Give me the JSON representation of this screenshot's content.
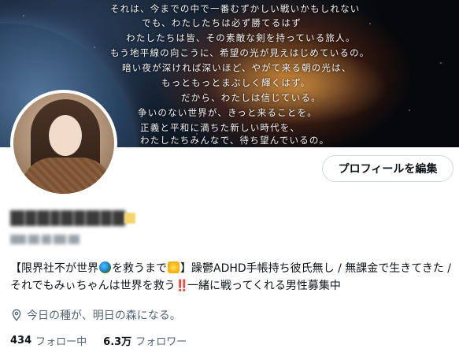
{
  "banner": {
    "lines": [
      "それは、今までの中で一番むずかしい戦いかもしれない",
      "でも、わたしたちは必ず勝てるはず",
      "わたしたちは皆、その素敵な剣を持っている旅人。",
      "もう地平線の向こうに、希望の光が見えはじめているの。",
      "暗い夜が深ければ深いほど、やがて来る朝の光は、",
      "もっともっとまぶしく輝くはず。",
      "だから、わたしは信じている。",
      "争いのない世界が、きっと来ることを。",
      "正義と平和に満ちた新しい時代を、",
      "わたしたちみんなで、待ち望んでいるの。"
    ]
  },
  "profile": {
    "edit_button_label": "プロフィールを編集",
    "bio": {
      "part1": "【限界社不が世界",
      "part2": "を救うまで",
      "part3": "】躁鬱ADHD手帳持ち彼氏無し / 無課金で生きてきた / それでもみぃちゃんは世界を救う",
      "bang": "‼️",
      "part4": "一緒に戦ってくれる男性募集中"
    },
    "location": "今日の種が、明日の森になる。",
    "following_count": "434",
    "following_label": "フォロー中",
    "followers_count": "6.3万",
    "followers_label": "フォロワー"
  },
  "icons": {
    "location": "location-pin-icon",
    "globe_emoji": "globe-emoji-icon",
    "dizzy_emoji": "dizzy-star-emoji-icon"
  },
  "colors": {
    "text_primary": "#0f1419",
    "text_secondary": "#536471",
    "button_border": "#cfd9de"
  }
}
